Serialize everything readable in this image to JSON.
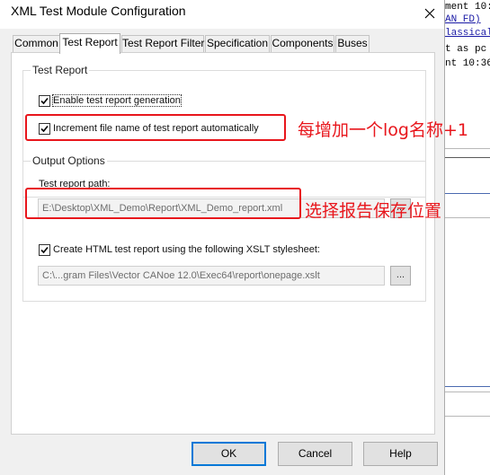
{
  "dialog": {
    "title": "XML Test Module Configuration",
    "close_glyph": "X"
  },
  "tabs": [
    {
      "label": "Common"
    },
    {
      "label": "Test Report"
    },
    {
      "label": "Test Report Filter"
    },
    {
      "label": "Specification"
    },
    {
      "label": "Components"
    },
    {
      "label": "Buses"
    }
  ],
  "test_report": {
    "group_title": "Test Report",
    "enable_label": "Enable test report generation",
    "enable_checked": true,
    "increment_label": "Increment file name of test report automatically",
    "increment_checked": true
  },
  "output_options": {
    "group_title": "Output Options",
    "path_label": "Test report path:",
    "path_value": "E:\\Desktop\\XML_Demo\\Report\\XML_Demo_report.xml",
    "path_browse": "...",
    "html_label": "Create HTML test report using the following XSLT stylesheet:",
    "html_checked": true,
    "xslt_value": "C:\\...gram Files\\Vector CANoe 12.0\\Exec64\\report\\onepage.xslt",
    "xslt_browse": "..."
  },
  "buttons": {
    "ok": "OK",
    "cancel": "Cancel",
    "help": "Help"
  },
  "annotations": {
    "increment_note": "每增加一个log名称+1",
    "path_note": "选择报告保存位置"
  },
  "background_app": {
    "lines": [
      "ment 10:",
      "AN FD)",
      "lassical",
      "t as pc",
      "nt 10:36"
    ]
  },
  "colors": {
    "annotation_red": "#e8161c",
    "default_button_border": "#0078d7"
  }
}
